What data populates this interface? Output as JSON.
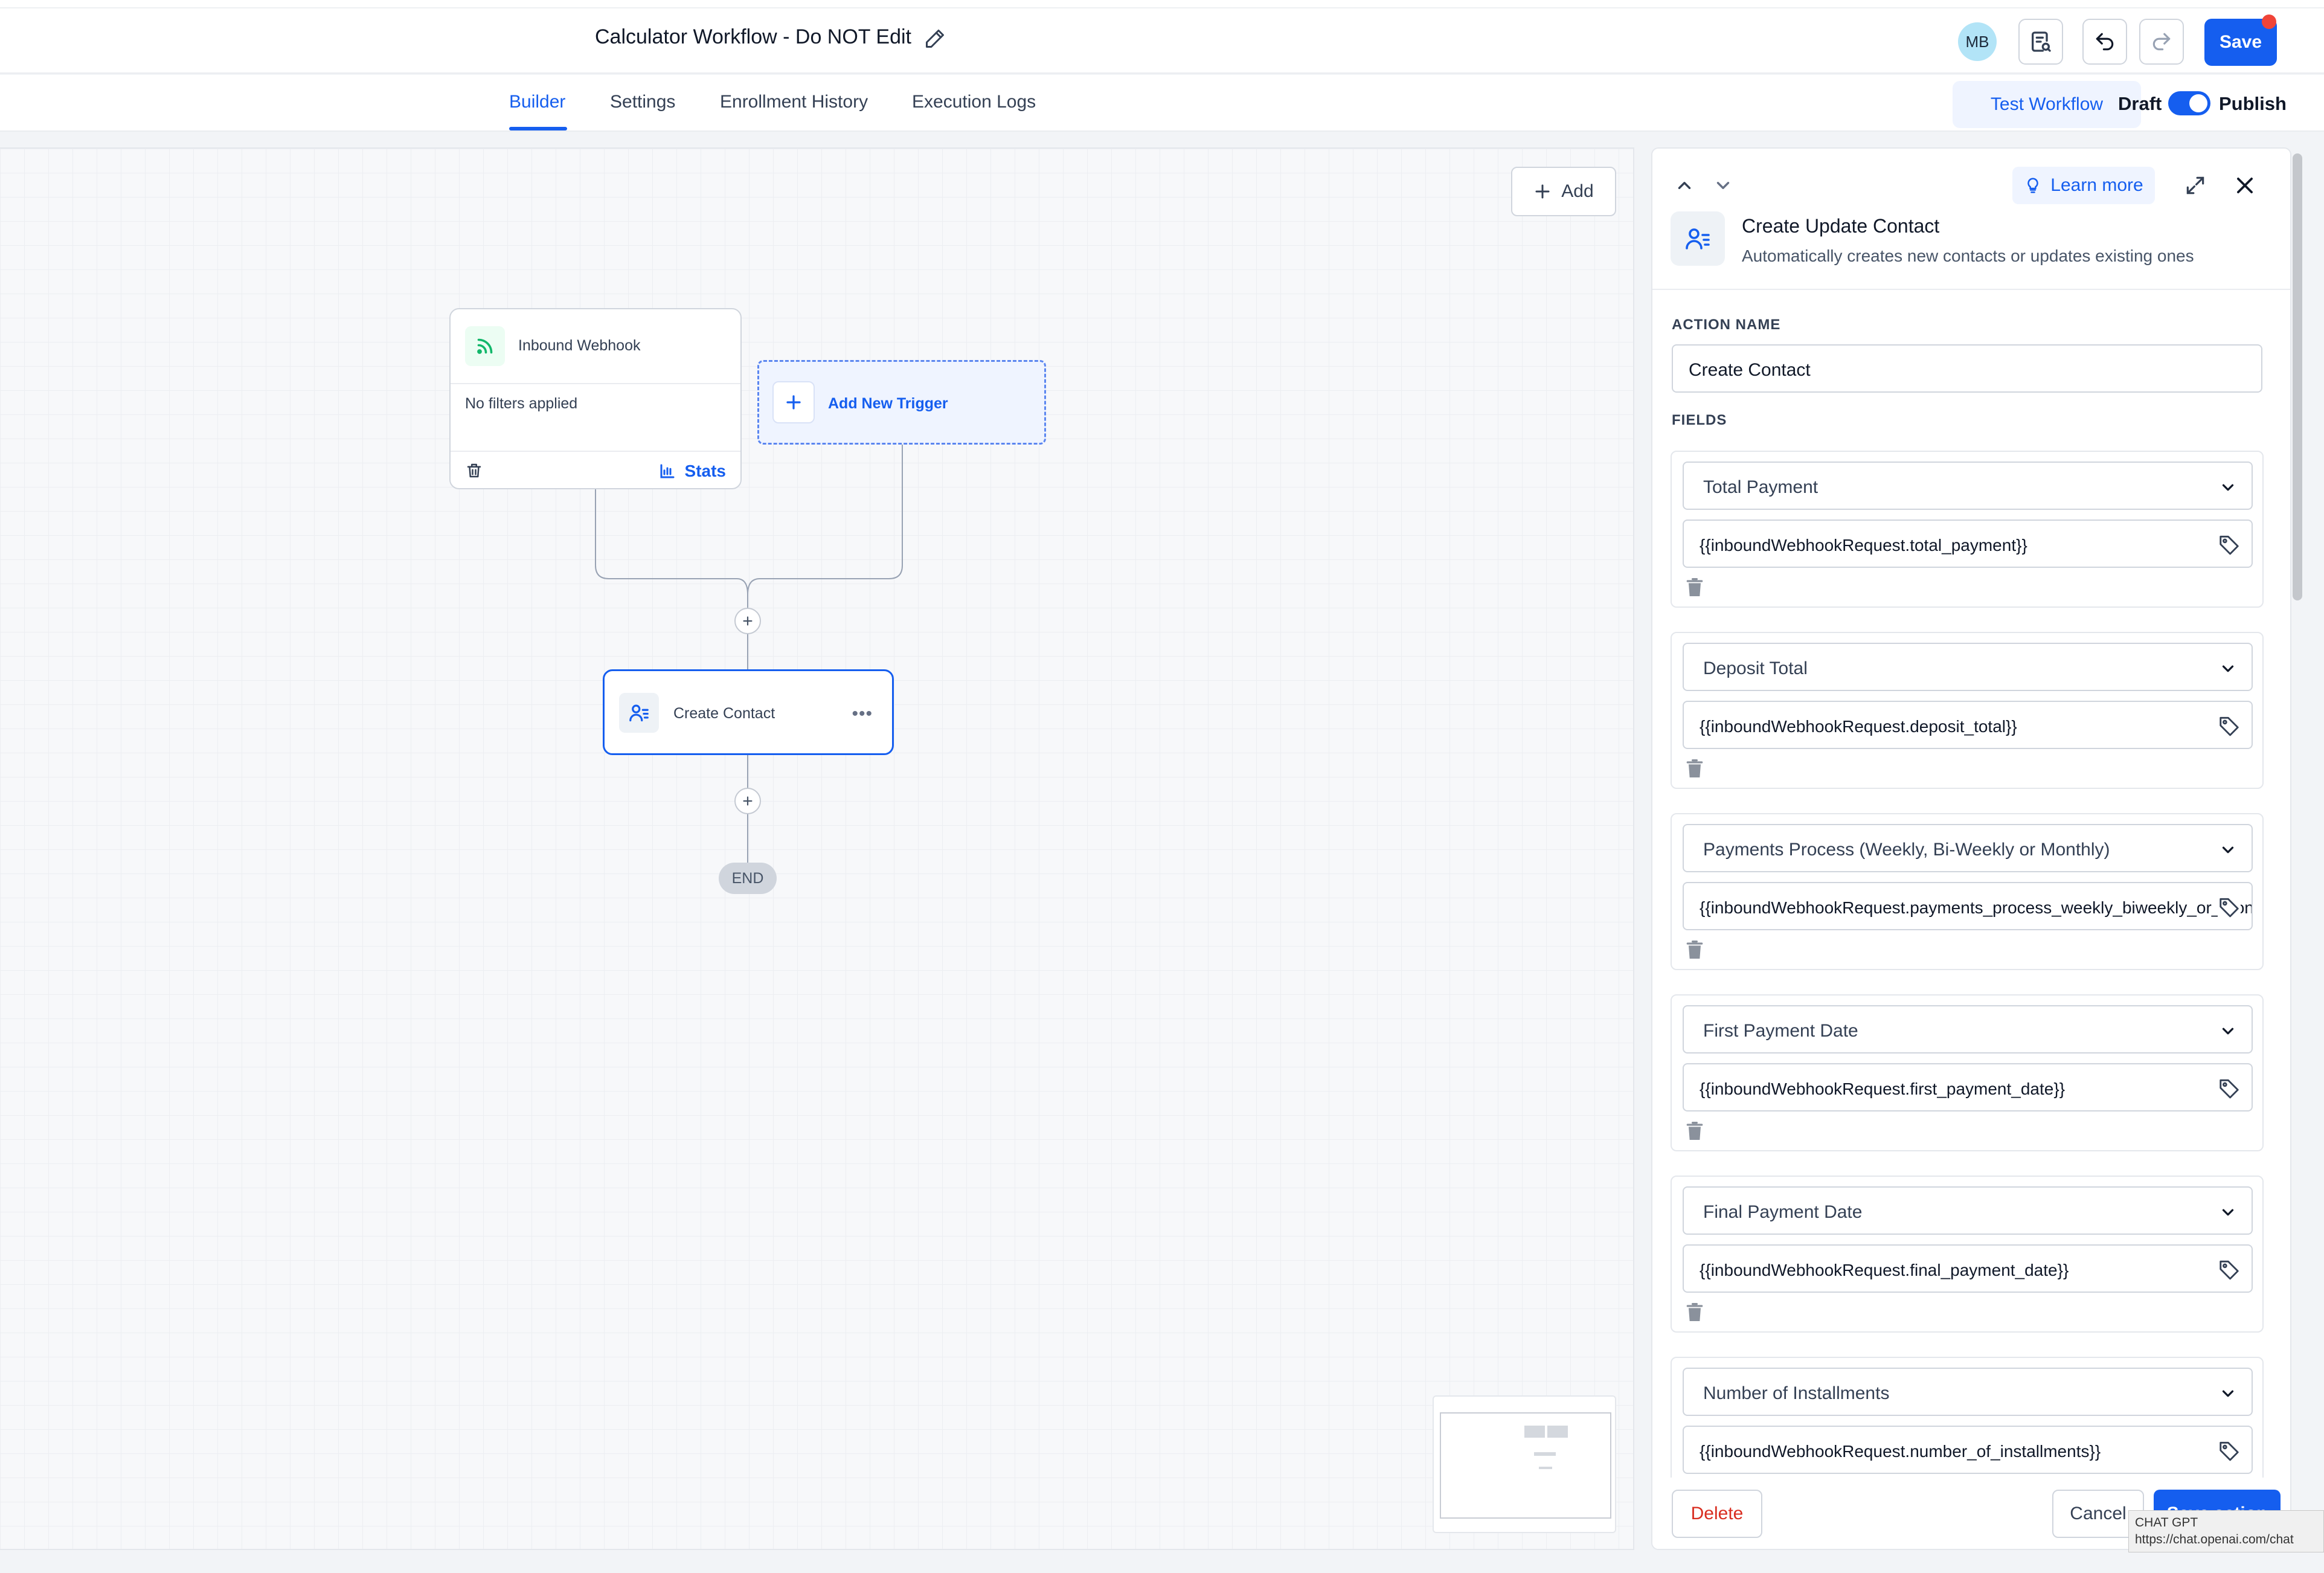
{
  "header": {
    "title": "Calculator Workflow - Do NOT Edit",
    "avatar_initials": "MB",
    "save_label": "Save"
  },
  "tabs": [
    {
      "label": "Builder",
      "active": true
    },
    {
      "label": "Settings"
    },
    {
      "label": "Enrollment History"
    },
    {
      "label": "Execution Logs"
    }
  ],
  "tabbar_right": {
    "test_label": "Test Workflow",
    "draft_label": "Draft",
    "publish_label": "Publish",
    "publish_on": true
  },
  "canvas": {
    "add_label": "Add",
    "trigger": {
      "title": "Inbound Webhook",
      "filters": "No filters applied",
      "stats_label": "Stats"
    },
    "add_trigger_label": "Add New Trigger",
    "action": {
      "label": "Create Contact"
    },
    "end_label": "END"
  },
  "panel": {
    "learn_more": "Learn more",
    "title": "Create Update Contact",
    "subtitle": "Automatically creates new contacts or updates existing ones",
    "action_name_label": "ACTION NAME",
    "action_name_value": "Create Contact",
    "fields_label": "FIELDS",
    "fields": [
      {
        "field": "Total Payment",
        "value": "{{inboundWebhookRequest.total_payment}}"
      },
      {
        "field": "Deposit Total",
        "value": "{{inboundWebhookRequest.deposit_total}}"
      },
      {
        "field": "Payments Process (Weekly, Bi-Weekly or Monthly)",
        "value": "{{inboundWebhookRequest.payments_process_weekly_biweekly_or_monthly}}"
      },
      {
        "field": "First Payment Date",
        "value": "{{inboundWebhookRequest.first_payment_date}}"
      },
      {
        "field": "Final Payment Date",
        "value": "{{inboundWebhookRequest.final_payment_date}}"
      },
      {
        "field": "Number of Installments",
        "value": "{{inboundWebhookRequest.number_of_installments}}"
      }
    ],
    "delete_label": "Delete",
    "cancel_label": "Cancel",
    "save_action_label": "Save action"
  },
  "tooltip": {
    "line1": "CHAT GPT",
    "line2": "https://chat.openai.com/chat"
  },
  "colors": {
    "primary": "#155eef",
    "danger": "#d92d20",
    "webhook_green": "#12b76a"
  }
}
